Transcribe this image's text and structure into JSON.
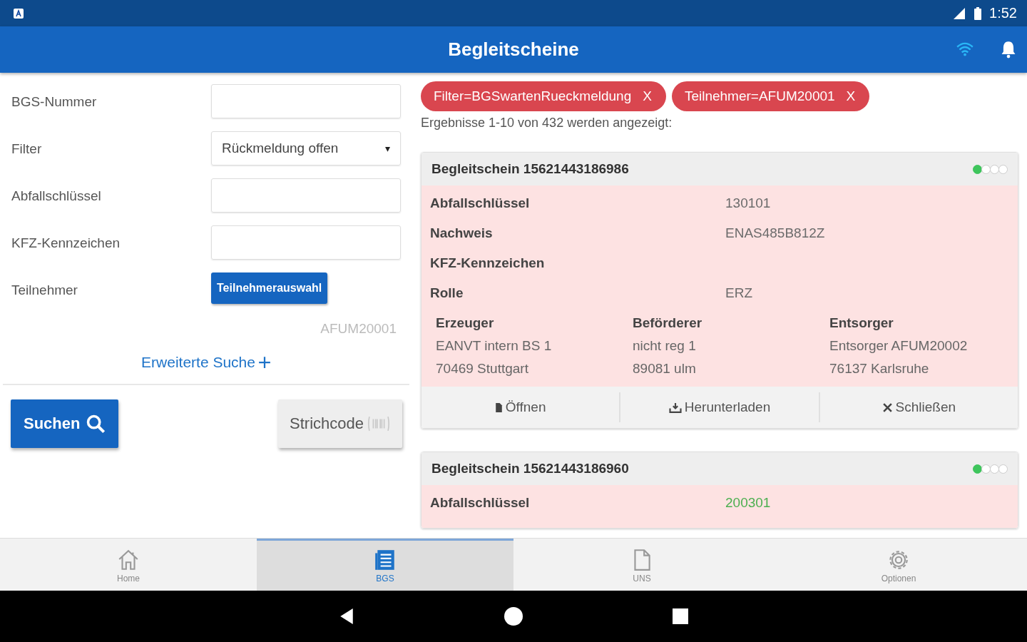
{
  "status_bar": {
    "time": "1:52"
  },
  "app_bar": {
    "title": "Begleitscheine"
  },
  "search_form": {
    "fields": [
      {
        "kind": "input",
        "label": "BGS-Nummer"
      },
      {
        "kind": "select",
        "label": "Filter",
        "value": "Rückmeldung offen",
        "caret": "▾"
      },
      {
        "kind": "input",
        "label": "Abfallschlüssel"
      },
      {
        "kind": "input",
        "label": "KFZ-Kennzeichen"
      },
      {
        "kind": "button",
        "label": "Teilnehmer",
        "button": "Teilnehmerauswahl",
        "note": "AFUM20001"
      }
    ],
    "advanced_link": "Erweiterte Suche",
    "search_button": "Suchen",
    "barcode_button": "Strichcode"
  },
  "filter_chips": [
    {
      "label": "Filter=BGSwartenRueckmeldung",
      "remove": "X"
    },
    {
      "label": "Teilnehmer=AFUM20001",
      "remove": "X"
    }
  ],
  "result_info": "Ergebnisse 1-10 von 432 werden angezeigt:",
  "cards": [
    {
      "title": "Begleitschein 15621443186986",
      "steps": [
        {
          "done": true
        },
        {
          "done": false
        },
        {
          "done": false
        },
        {
          "done": false
        }
      ],
      "rows": [
        {
          "label": "Abfallschlüssel",
          "value": "130101",
          "highlighted": false
        },
        {
          "label": "Nachweis",
          "value": "ENAS485B812Z",
          "highlighted": false
        },
        {
          "label": "KFZ-Kennzeichen"
        },
        {
          "label": "Rolle",
          "value": "ERZ",
          "highlighted": false
        }
      ],
      "parties": [
        {
          "heading": "Erzeuger",
          "lines": [
            "EANVT intern BS 1",
            "70469 Stuttgart"
          ]
        },
        {
          "heading": "Beförderer",
          "lines": [
            "nicht reg 1",
            "89081 ulm"
          ]
        },
        {
          "heading": "Entsorger",
          "lines": [
            "Entsorger AFUM20002",
            "76137 Karlsruhe"
          ]
        }
      ],
      "actions": [
        {
          "kind": "open",
          "label": "Öffnen"
        },
        {
          "kind": "download",
          "label": "Herunterladen"
        },
        {
          "kind": "close",
          "label": "Schließen"
        }
      ]
    },
    {
      "title": "Begleitschein 15621443186960",
      "steps": [
        {
          "done": true
        },
        {
          "done": false
        },
        {
          "done": false
        },
        {
          "done": false
        }
      ],
      "rows": [
        {
          "label": "Abfallschlüssel",
          "value": "200301",
          "highlighted": true
        }
      ]
    }
  ],
  "bottom_nav": [
    {
      "kind": "home",
      "label": "Home",
      "selected": false
    },
    {
      "kind": "list",
      "label": "BGS",
      "selected": true
    },
    {
      "kind": "doc",
      "label": "UNS",
      "selected": false
    },
    {
      "kind": "gear",
      "label": "Optionen",
      "selected": false
    }
  ]
}
